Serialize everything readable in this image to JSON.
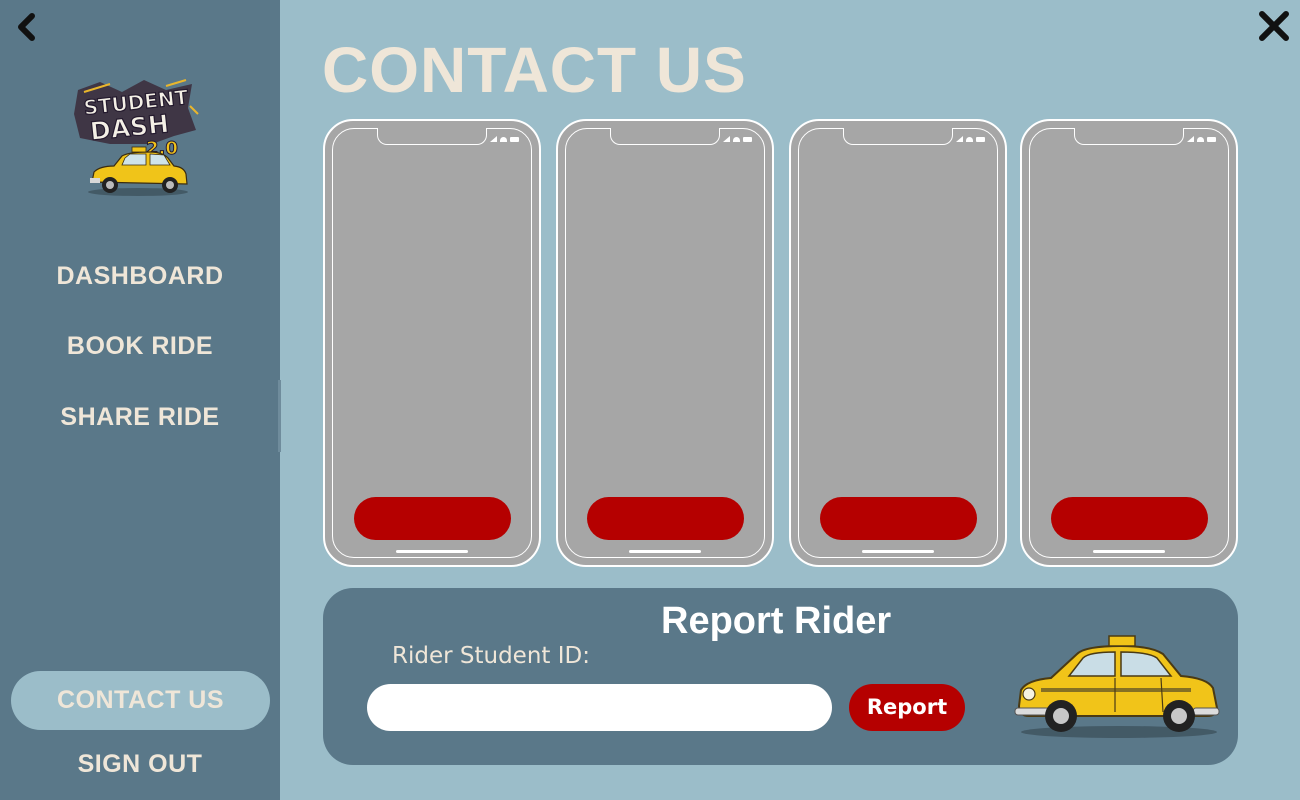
{
  "sidebar": {
    "logo": {
      "text_line1": "STUDENT",
      "text_line2": "DASH",
      "text_version": "2.0"
    },
    "nav": {
      "dashboard": "DASHBOARD",
      "book_ride": "BOOK RIDE",
      "share_ride": "SHARE RIDE",
      "contact_us": "CONTACT US",
      "sign_out": "SIGN OUT"
    },
    "active_item": "contact_us"
  },
  "header": {
    "back_icon": "chevron-left-icon",
    "close_icon": "close-icon"
  },
  "main": {
    "title": "CONTACT US",
    "phone_cards": [
      {
        "button_label": ""
      },
      {
        "button_label": ""
      },
      {
        "button_label": ""
      },
      {
        "button_label": ""
      }
    ],
    "report": {
      "title": "Report Rider",
      "field_label": "Rider Student ID:",
      "field_value": "",
      "field_placeholder": "",
      "button_label": "Report"
    }
  },
  "colors": {
    "background": "#9bbdc9",
    "sidebar": "#5a7889",
    "text_cream": "#efe6d8",
    "button_red": "#b50000",
    "phone_screen": "#a6a6a6"
  }
}
